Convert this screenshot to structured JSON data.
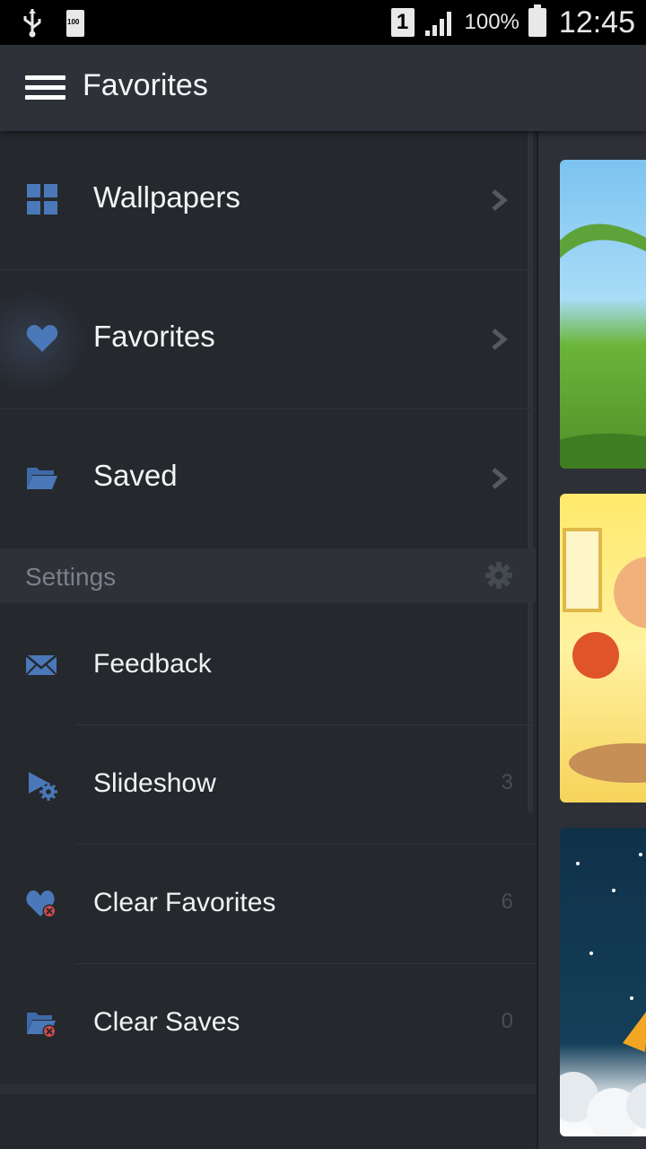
{
  "status_bar": {
    "sim_slot": "1",
    "battery_label": "100%",
    "time": "12:45",
    "notification_battery_badge": "100",
    "icons": [
      "usb-icon",
      "battery-notification-icon",
      "sim-icon",
      "signal-icon",
      "battery-icon"
    ]
  },
  "action_bar": {
    "title": "Favorites",
    "menu_icon": "hamburger-icon"
  },
  "drawer": {
    "nav_items": [
      {
        "label": "Wallpapers",
        "icon": "grid-icon"
      },
      {
        "label": "Favorites",
        "icon": "heart-icon",
        "selected": true
      },
      {
        "label": "Saved",
        "icon": "folder-open-icon"
      }
    ],
    "settings_header": {
      "label": "Settings",
      "icon": "gear-icon"
    },
    "settings_items": [
      {
        "label": "Feedback",
        "icon": "envelope-icon",
        "count": ""
      },
      {
        "label": "Slideshow",
        "icon": "slideshow-settings-icon",
        "count": "3"
      },
      {
        "label": "Clear Favorites",
        "icon": "heart-remove-icon",
        "count": "6"
      },
      {
        "label": "Clear Saves",
        "icon": "folder-remove-icon",
        "count": "0"
      }
    ]
  },
  "colors": {
    "accent_icon": "#4a78b8",
    "drawer_bg": "#25282d",
    "header_bg": "#2e3138",
    "remove_badge": "#d24a4a"
  },
  "content": {
    "thumbnails": [
      "cartoon-landscape-wallpaper",
      "cartoon-kid-wallpaper",
      "space-clouds-wallpaper"
    ]
  }
}
